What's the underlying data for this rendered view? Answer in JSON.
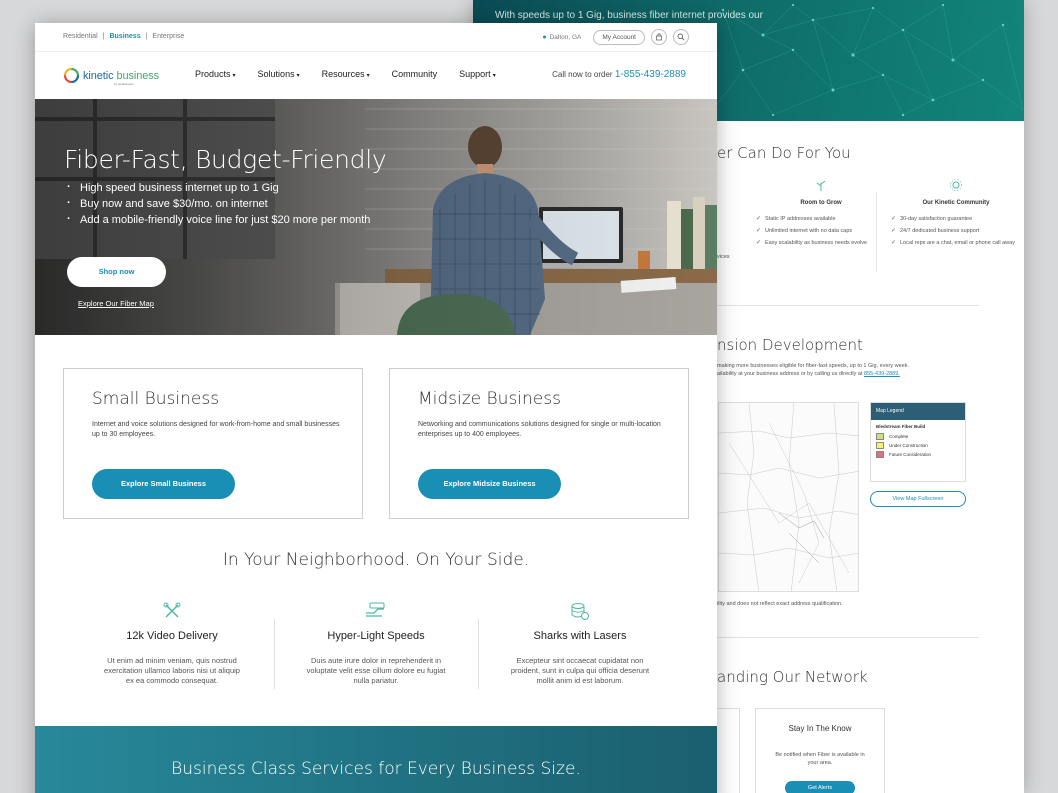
{
  "back_page": {
    "hero_text": "With speeds up to 1 Gig, business fiber internet provides our",
    "section1_title": "er Can Do For You",
    "columns": [
      {
        "title": "Room to Grow",
        "items": [
          "Static IP addresses available",
          "Unlimited internet with no data caps",
          "Easy scalability as business needs evolve"
        ]
      },
      {
        "title": "Our Kinetic Community",
        "items": [
          "30-day satisfaction guarantee",
          "24/7 dedicated business support",
          "Local reps are a chat, email or phone call away"
        ]
      }
    ],
    "col_left_fragment": "vices",
    "section2_title": "nsion Development",
    "section2_line1": "making more businesses eligible for fiber-fast speeds, up to 1 Gig, every week.",
    "section2_line2": "ailability at your business address or by calling us directly at",
    "section2_phone": "855-439-2889.",
    "map_caption": "ility and does not reflect exact address qualification.",
    "legend": {
      "title": "Map Legend",
      "subtitle": "Bledstream Fiber Build",
      "items": [
        {
          "label": "Complete",
          "color": "#c9e27a"
        },
        {
          "label": "Under Construction",
          "color": "#f3f07a"
        },
        {
          "label": "Future Consideration",
          "color": "#e46b7c"
        }
      ]
    },
    "view_map_btn": "View Map Fullscreen",
    "section3_title": "anding Our Network",
    "stay": {
      "title": "Stay In The Know",
      "text": "Be notified when Fiber is available in your area.",
      "button": "Get Alerts"
    }
  },
  "utility": {
    "segments": [
      "Residential",
      "Business",
      "Enterprise"
    ],
    "active_segment": "Business",
    "location": "Dalton, GA",
    "my_account": "My Account"
  },
  "nav": {
    "logo_a": "kinetic",
    "logo_b": "business",
    "logo_sub": "by windstream",
    "items": [
      {
        "label": "Products",
        "dropdown": true
      },
      {
        "label": "Solutions",
        "dropdown": true
      },
      {
        "label": "Resources",
        "dropdown": true
      },
      {
        "label": "Community",
        "dropdown": false
      },
      {
        "label": "Support",
        "dropdown": true
      }
    ],
    "call_text": "Call now to order",
    "phone": "1-855-439-2889"
  },
  "hero": {
    "title": "Fiber-Fast, Budget-Friendly",
    "bullets": [
      "High speed business internet up to 1 Gig",
      "Buy now and save $30/mo. on internet",
      "Add a mobile-friendly voice line for just $20 more per month"
    ],
    "cta": "Shop now",
    "link": "Explore Our Fiber Map"
  },
  "cards": [
    {
      "title": "Small Business",
      "text": "Internet and voice solutions designed for work-from-home and small businesses up to 30 employees.",
      "button": "Explore Small Business"
    },
    {
      "title": "Midsize Business",
      "text": "Networking and communications solutions designed for single or multi-location enterprises up to 400 employees.",
      "button": "Explore Midsize Business"
    }
  ],
  "neighborhood_title": "In Your Neighborhood. On Your Side.",
  "features": [
    {
      "icon": "tools-icon",
      "title": "12k Video Delivery",
      "text": "Ut enim ad minim veniam, quis nostrud exercitation ullamco laboris nisi ut aliquip ex ea commodo consequat."
    },
    {
      "icon": "speed-hand-icon",
      "title": "Hyper-Light Speeds",
      "text": "Duis aute irure dolor in reprehenderit in voluptate velit esse cillum dolore eu fugiat nulla pariatur."
    },
    {
      "icon": "coins-shield-icon",
      "title": "Sharks with Lasers",
      "text": "Excepteur sint occaecat cupidatat non proident, sunt in culpa qui officia deserunt mollit anim id est laborum."
    }
  ],
  "banner_title": "Business Class Services for Every Business Size.",
  "colors": {
    "accent": "#1a8fb5",
    "green": "#4db8a0",
    "banner": "#1f6f7f"
  }
}
